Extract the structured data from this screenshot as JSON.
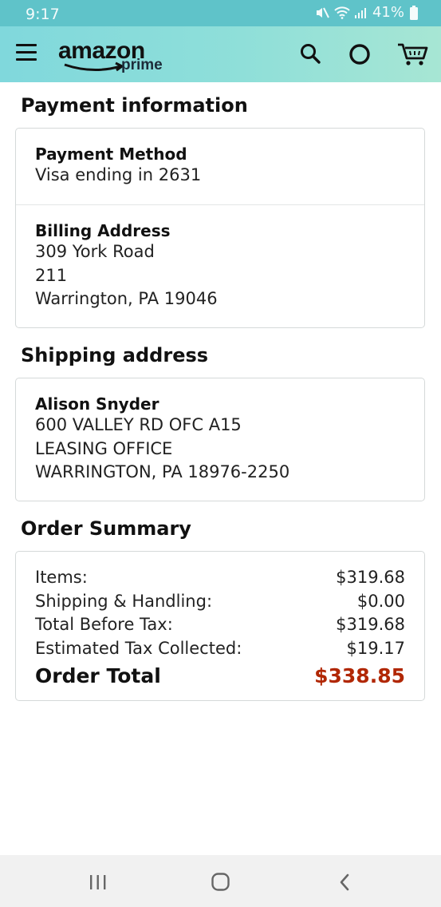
{
  "status_bar": {
    "time": "9:17",
    "battery": "41%"
  },
  "header": {
    "logo_word": "amazon",
    "logo_sub": "prime",
    "icons": [
      "menu-icon",
      "search-icon",
      "alexa-icon",
      "cart-icon"
    ]
  },
  "payment": {
    "section_title": "Payment information",
    "method_label": "Payment Method",
    "method_value": "Visa ending in 2631",
    "billing_label": "Billing Address",
    "billing_lines": [
      "309 York Road",
      "211",
      "Warrington, PA 19046"
    ]
  },
  "shipping": {
    "section_title": "Shipping address",
    "name": "Alison Snyder",
    "lines": [
      "600 VALLEY RD OFC A15",
      "LEASING OFFICE",
      "WARRINGTON, PA 18976-2250"
    ]
  },
  "summary": {
    "section_title": "Order Summary",
    "rows": [
      {
        "label": "Items:",
        "amount": "$319.68"
      },
      {
        "label": "Shipping & Handling:",
        "amount": "$0.00"
      },
      {
        "label": "Total Before Tax:",
        "amount": "$319.68"
      },
      {
        "label": "Estimated Tax Collected:",
        "amount": "$19.17"
      }
    ],
    "total_label": "Order Total",
    "total_amount": "$338.85",
    "total_color": "#b12704"
  },
  "nav_bar": {
    "buttons": [
      "recent-apps-icon",
      "home-icon",
      "back-icon"
    ]
  }
}
